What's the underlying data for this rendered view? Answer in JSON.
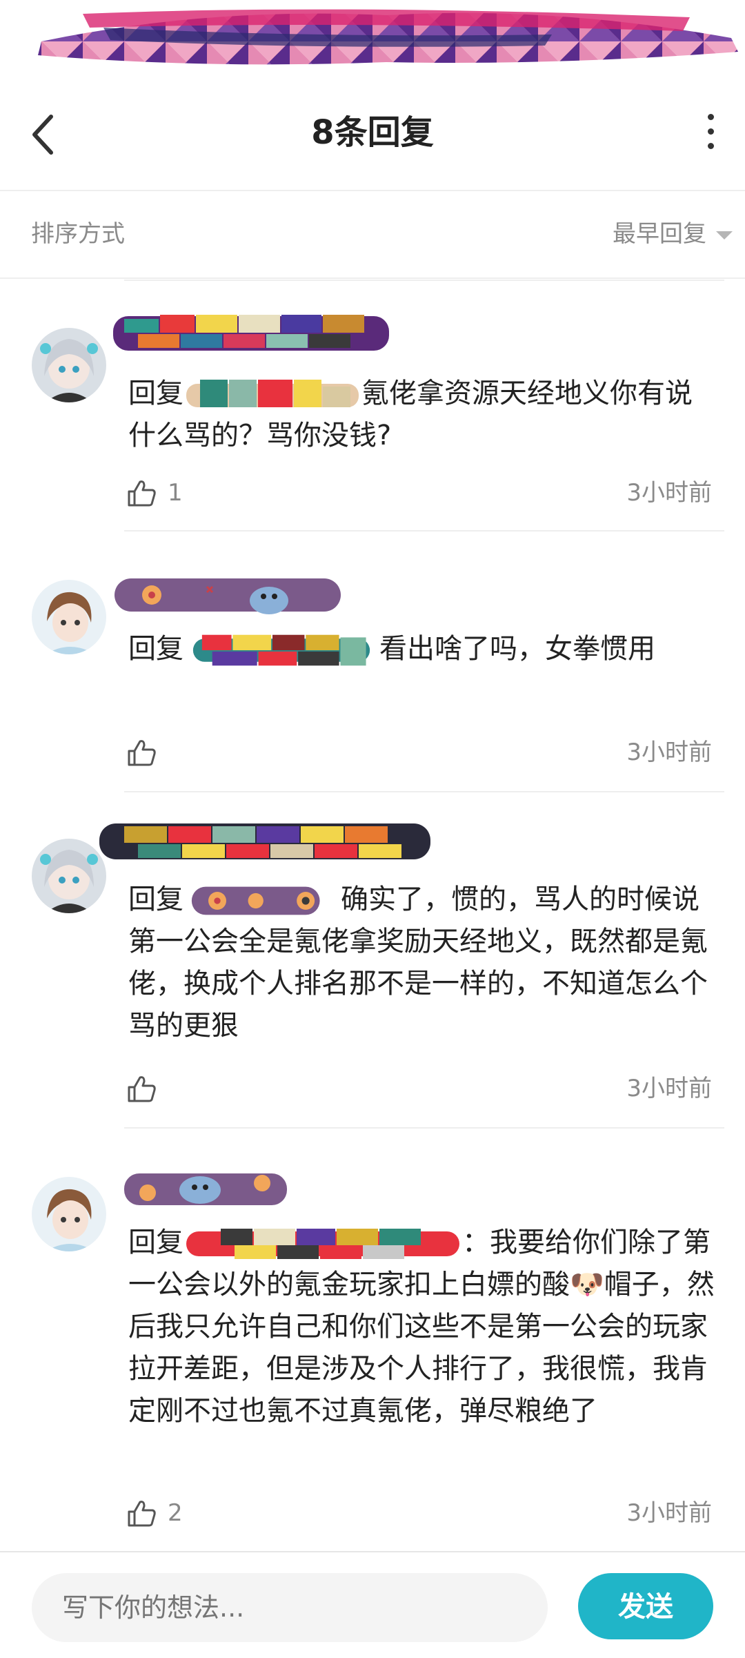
{
  "header": {
    "title": "8条回复"
  },
  "sort": {
    "label": "排序方式",
    "value": "最早回复"
  },
  "comments": [
    {
      "reply_prefix": "回复",
      "text": "氪佬拿资源天经地义你有说什么骂的？骂你没钱?",
      "likes": "1",
      "time": "3小时前"
    },
    {
      "reply_prefix": "回复",
      "text": "看出啥了吗，女拳惯用",
      "likes": "",
      "time": "3小时前"
    },
    {
      "reply_prefix": "回复",
      "text": "确实了，惯的，骂人的时候说第一公会全是氪佬拿奖励天经地义，既然都是氪佬，换成个人排名那不是一样的，不知道怎么个骂的更狠",
      "likes": "",
      "time": "3小时前"
    },
    {
      "reply_prefix": "回复",
      "text_before": "：我要给你们除了第一公会以外的氪金玩家扣上白嫖的酸",
      "emoji": "🐶",
      "text_after": "帽子，然后我只允许自己和你们这些不是第一公会的玩家拉开差距，但是涉及个人排行了，我很慌，我肯定刚不过也氪不过真氪佬，弹尽粮绝了",
      "likes": "2",
      "time": "3小时前"
    }
  ],
  "composer": {
    "placeholder": "写下你的想法...",
    "send_label": "发送"
  },
  "colors": {
    "accent": "#20b5c8",
    "muted": "#8a8a8a"
  }
}
